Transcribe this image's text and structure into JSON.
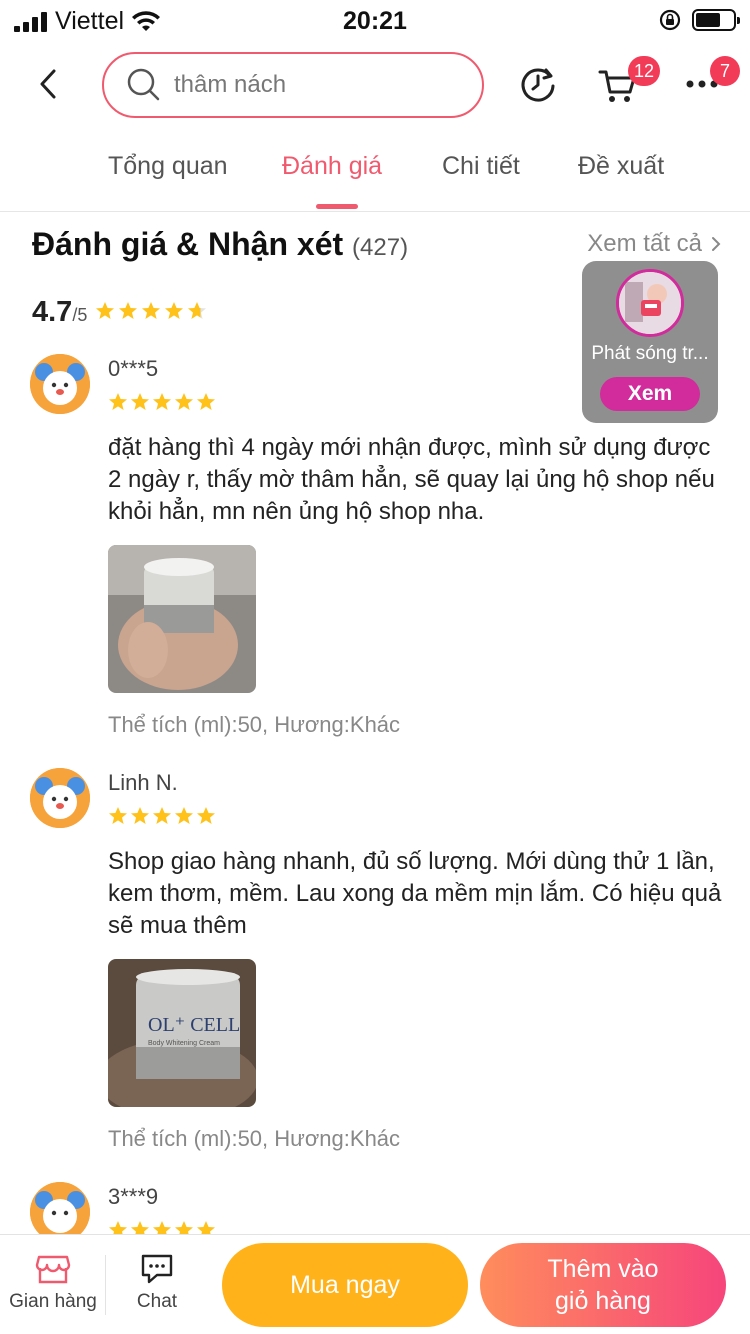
{
  "status_bar": {
    "carrier": "Viettel",
    "time": "20:21"
  },
  "header": {
    "search_text": "thâm nách",
    "cart_badge": "12",
    "more_badge": "7"
  },
  "tabs": [
    "Tổng quan",
    "Đánh giá",
    "Chi tiết",
    "Đề xuất"
  ],
  "active_tab": "Đánh giá",
  "reviews_section": {
    "title": "Đánh giá & Nhận xét",
    "count": "(427)",
    "see_all": "Xem tất cả",
    "score": "4.7",
    "score_max": "/5",
    "score_stars": 4.7
  },
  "live": {
    "label": "Phát sóng tr...",
    "button": "Xem"
  },
  "reviews": [
    {
      "user": "0***5",
      "stars": 5,
      "text": "đặt hàng thì 4 ngày mới nhận được, mình sử dụng được 2 ngày r, thấy mờ thâm hẳn, sẽ quay lại ủng hộ shop nếu khỏi hẳn, mn nên ủng hộ shop nha.",
      "variant": "Thể tích (ml):50, Hương:Khác"
    },
    {
      "user": "Linh N.",
      "stars": 5,
      "text": "Shop giao hàng nhanh, đủ số lượng. Mới dùng thử 1 lần, kem thơm, mềm.  Lau xong da mềm mịn lắm. Có hiệu quả sẽ mua thêm",
      "variant": "Thể tích (ml):50, Hương:Khác",
      "photo_brand": "OL⁺ CELL",
      "photo_sub": "Body Whitening Cream"
    },
    {
      "user": "3***9",
      "stars": 5
    }
  ],
  "bottom_bar": {
    "store": "Gian hàng",
    "chat": "Chat",
    "buy_now": "Mua ngay",
    "add_to_cart": "Thêm vào giỏ hàng"
  },
  "colors": {
    "accent": "#f05a6e",
    "buy": "#ffb21a",
    "star": "#ffc21a",
    "live": "#d12b9c"
  }
}
